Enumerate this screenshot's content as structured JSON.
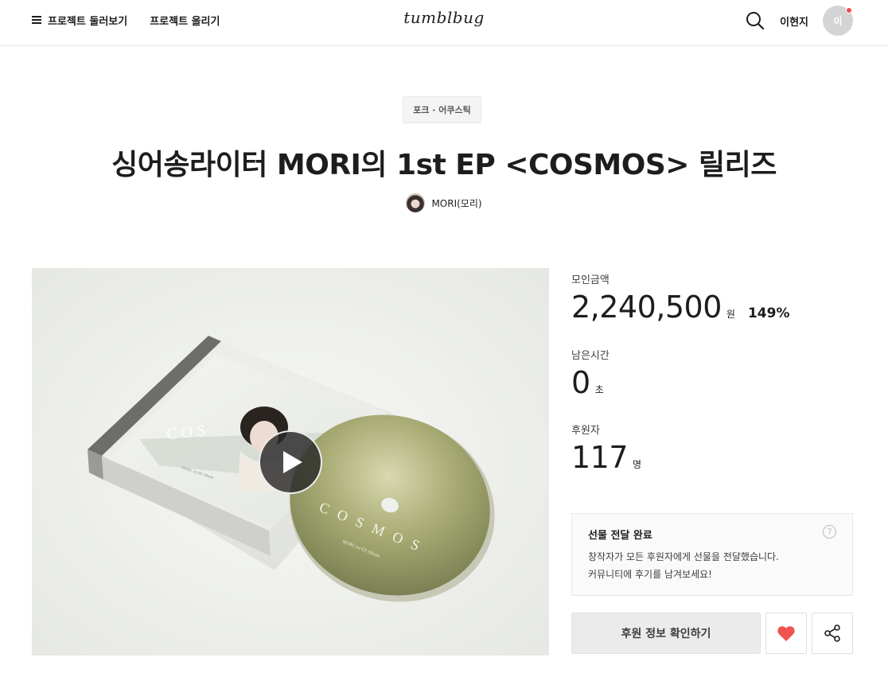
{
  "header": {
    "browse_label": "프로젝트 둘러보기",
    "upload_label": "프로젝트 올리기",
    "logo_text": "tumblbug",
    "user_name": "이현지",
    "avatar_initial": "이"
  },
  "project": {
    "category": "포크 · 어쿠스틱",
    "title": "싱어송라이터 MORI의 1st EP <COSMOS> 릴리즈",
    "creator_name": "MORI(모리)"
  },
  "media": {
    "cd_title": "COSMOS",
    "cd_subtitle": "MORI 1st EP Album",
    "cover_letters": "C O S",
    "cover_caption": "MORI 1st EP Album"
  },
  "stats": {
    "funded_label": "모인금액",
    "funded_amount": "2,240,500",
    "funded_unit": "원",
    "funded_percent": "149%",
    "time_label": "남은시간",
    "time_value": "0",
    "time_unit": "초",
    "backers_label": "후원자",
    "backers_value": "117",
    "backers_unit": "명"
  },
  "notice": {
    "title": "선물 전달 완료",
    "line1": "창작자가 모든 후원자에게 선물을 전달했습니다.",
    "line2": "커뮤니티에 후기를 남겨보세요!",
    "help_symbol": "?"
  },
  "actions": {
    "primary_label": "후원 정보 확인하기"
  },
  "colors": {
    "accent_red": "#f04b4b",
    "heart": "#ef5350",
    "button_bg": "#ebebeb"
  },
  "icons": {
    "menu": "hamburger-icon",
    "search": "search-icon",
    "play": "play-icon",
    "like": "heart-icon",
    "share": "share-icon",
    "help": "question-icon"
  }
}
